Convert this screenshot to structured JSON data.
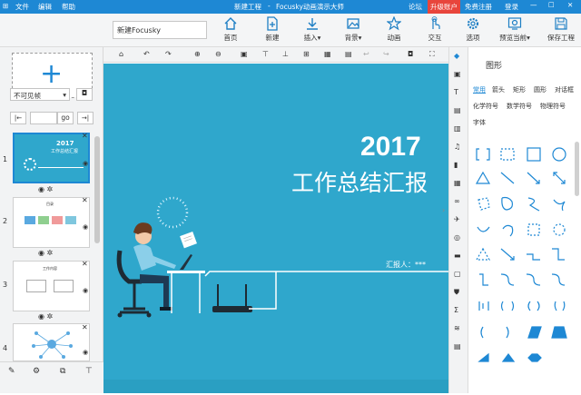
{
  "titlebar": {
    "menus": [
      "文件",
      "编辑",
      "帮助"
    ],
    "title_left": "新建工程",
    "title": "Focusky动画演示大师",
    "forum": "论坛",
    "upgrade": "升级账户",
    "register": "免费注册",
    "login": "登录",
    "upgrade_color": "#e8453c"
  },
  "doc": {
    "name": "新建Focusky"
  },
  "toolbar": {
    "home": "首页",
    "new": "新建",
    "insert": "插入",
    "background": "背景",
    "animation": "动画",
    "interaction": "交互",
    "options": "选项",
    "preview": "预览当前",
    "save": "保存工程"
  },
  "leftpanel": {
    "visibility": "不可见帧",
    "go": "go",
    "slides": [
      {
        "num": "1",
        "title": "2017",
        "subtitle": "工作总结汇报"
      },
      {
        "num": "2",
        "title": "目录"
      },
      {
        "num": "3",
        "title": "工作内容"
      },
      {
        "num": "4"
      }
    ]
  },
  "slide": {
    "year": "2017",
    "title": "工作总结汇报",
    "reporter": "汇报人：***",
    "bg_color": "#2fa7cc"
  },
  "rightpanel": {
    "title": "图形",
    "tabs": [
      "常用",
      "箭头",
      "矩形",
      "圆形",
      "对话框"
    ],
    "tabs2": [
      "化学符号",
      "数学符号",
      "物理符号"
    ],
    "tabs3": [
      "字体"
    ]
  }
}
